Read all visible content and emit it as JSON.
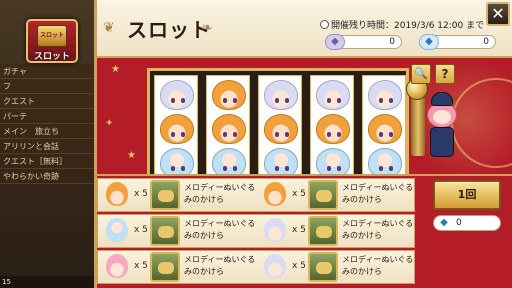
{
  "background": {
    "rows": [
      "ガチャ",
      "フ",
      "クエスト",
      "パーテ",
      "メイン　旅立ち",
      "アリリンと会話",
      "クエスト［無料］",
      "やわらかい奇跡"
    ],
    "bottom_text": "15"
  },
  "slot_menu": {
    "label": "スロット",
    "icon_text": "スロット"
  },
  "header": {
    "title": "スロット",
    "time_label": "開催残り時間：2019/3/6  12:00  まで",
    "currency_1": {
      "icon": "purple-gem-icon",
      "value": "0"
    },
    "currency_2": {
      "icon": "blue-gem-icon",
      "value": "0"
    },
    "close_icon": "close-icon"
  },
  "machine": {
    "reels": [
      [
        "silver",
        "orange",
        "blue"
      ],
      [
        "orange",
        "orange",
        "blue"
      ],
      [
        "silver",
        "orange",
        "blue"
      ],
      [
        "silver",
        "orange",
        "blue"
      ],
      [
        "silver",
        "orange",
        "blue"
      ]
    ],
    "search_icon": "magnifier-icon",
    "help_label": "?"
  },
  "prizes": {
    "rows": [
      [
        {
          "symbol": "orange",
          "count": "x 5",
          "prize": "メロディーぬいぐるみのかけら"
        },
        {
          "symbol": "orange",
          "count": "x 5",
          "prize": "メロディーぬいぐるみのかけら"
        }
      ],
      [
        {
          "symbol": "blue",
          "count": "x 5",
          "prize": "メロディーぬいぐるみのかけら"
        },
        {
          "symbol": "silver",
          "count": "x 5",
          "prize": "メロディーぬいぐるみのかけら"
        }
      ],
      [
        {
          "symbol": "pink",
          "count": "x 5",
          "prize": "メロディーぬいぐるみのかけら"
        },
        {
          "symbol": "silver",
          "count": "x 5",
          "prize": "メロディーぬいぐるみのかけら"
        }
      ]
    ]
  },
  "controls": {
    "spin_label": "1回",
    "cost_icon": "blue-gem-icon",
    "cost_value": "0"
  },
  "colors": {
    "panel_red": "#b41d28",
    "gold": "#d9b55e",
    "cream": "#f3e9d4"
  }
}
